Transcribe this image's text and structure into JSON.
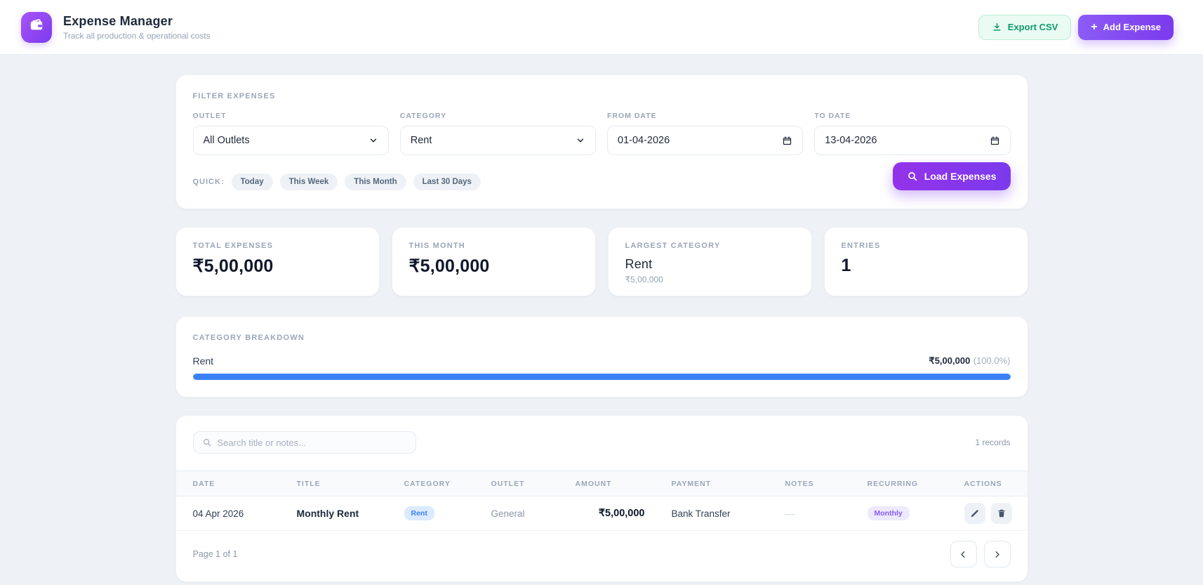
{
  "header": {
    "title": "Expense Manager",
    "subtitle": "Track all production & operational costs",
    "export_label": "Export CSV",
    "add_label": "Add Expense",
    "plus": "+"
  },
  "filters": {
    "section_label": "Filter Expenses",
    "fields": [
      {
        "label": "Outlet",
        "value": "All Outlets",
        "type": "select"
      },
      {
        "label": "Category",
        "value": "Rent",
        "type": "select"
      },
      {
        "label": "From Date",
        "value": "01-04-2026",
        "type": "date"
      },
      {
        "label": "To Date",
        "value": "13-04-2026",
        "type": "date"
      }
    ],
    "quick_label": "QUICK:",
    "quick_options": [
      "Today",
      "This Week",
      "This Month",
      "Last 30 Days"
    ],
    "load_button": "Load Expenses"
  },
  "stats": [
    {
      "label": "Total Expenses",
      "value": "₹5,00,000"
    },
    {
      "label": "This Month",
      "value": "₹5,00,000"
    },
    {
      "label": "Largest Category",
      "value": "Rent",
      "sub": "₹5,00,000"
    },
    {
      "label": "Entries",
      "value": "1"
    }
  ],
  "breakdown": {
    "section_label": "Category Breakdown",
    "rows": [
      {
        "category": "Rent",
        "amount": "₹5,00,000",
        "percent": "(100.0%)",
        "bar_percent": 100
      }
    ]
  },
  "table": {
    "search_placeholder": "Search title or notes...",
    "records_text": "1 records",
    "columns": [
      "Date",
      "Title",
      "Category",
      "Outlet",
      "Amount",
      "Payment",
      "Notes",
      "Recurring",
      "Actions"
    ],
    "rows": [
      {
        "date": "04 Apr 2026",
        "title": "Monthly Rent",
        "category": "Rent",
        "outlet": "General",
        "amount": "₹5,00,000",
        "payment": "Bank Transfer",
        "notes": "—",
        "recurring": "Monthly"
      }
    ],
    "pagination": "Page 1 of 1"
  },
  "colors": {
    "accent_purple": "#7c3aed",
    "accent_green": "#0d9b6c",
    "bar_blue": "#3b82f6",
    "category_badge_bg": "#dbeafe",
    "recurring_badge_bg": "#ede9fe"
  }
}
